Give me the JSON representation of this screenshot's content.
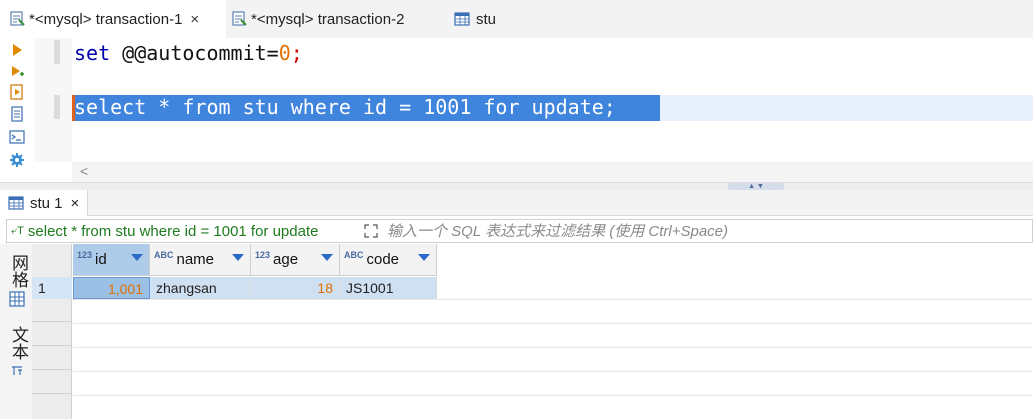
{
  "tabs": [
    {
      "label": "*<mysql> transaction-1",
      "close": "×",
      "icon": "sql-editor-icon",
      "active": true
    },
    {
      "label": "*<mysql> transaction-2",
      "icon": "sql-editor-icon",
      "active": false
    },
    {
      "label": "stu",
      "icon": "table-icon",
      "active": false
    }
  ],
  "editor": {
    "line1": {
      "kw1": "set",
      "text": " @@autocommit=",
      "num": "0",
      "semi": ";"
    },
    "line2": {
      "text": "select * from stu where id = 1001 for update;"
    },
    "scroll_left": "<"
  },
  "results": {
    "tab_label": "stu 1",
    "tab_close": "×",
    "filter_query": "select * from stu where id = 1001 for update",
    "filter_placeholder": "输入一个 SQL 表达式来过滤结果 (使用 Ctrl+Space)",
    "side_grid_label": "网格",
    "side_text_label": "文本",
    "columns": [
      {
        "type": "123",
        "name": "id"
      },
      {
        "type": "ABC",
        "name": "name"
      },
      {
        "type": "123",
        "name": "age"
      },
      {
        "type": "ABC",
        "name": "code"
      }
    ],
    "rows": [
      {
        "num": "1",
        "id": "1,001",
        "name": "zhangsan",
        "age": "18",
        "code": "JS1001"
      }
    ]
  },
  "colors": {
    "accent": "#3f84dd",
    "selection": "#cfe0f3",
    "keyword": "#0000aa",
    "number": "#e07000"
  }
}
